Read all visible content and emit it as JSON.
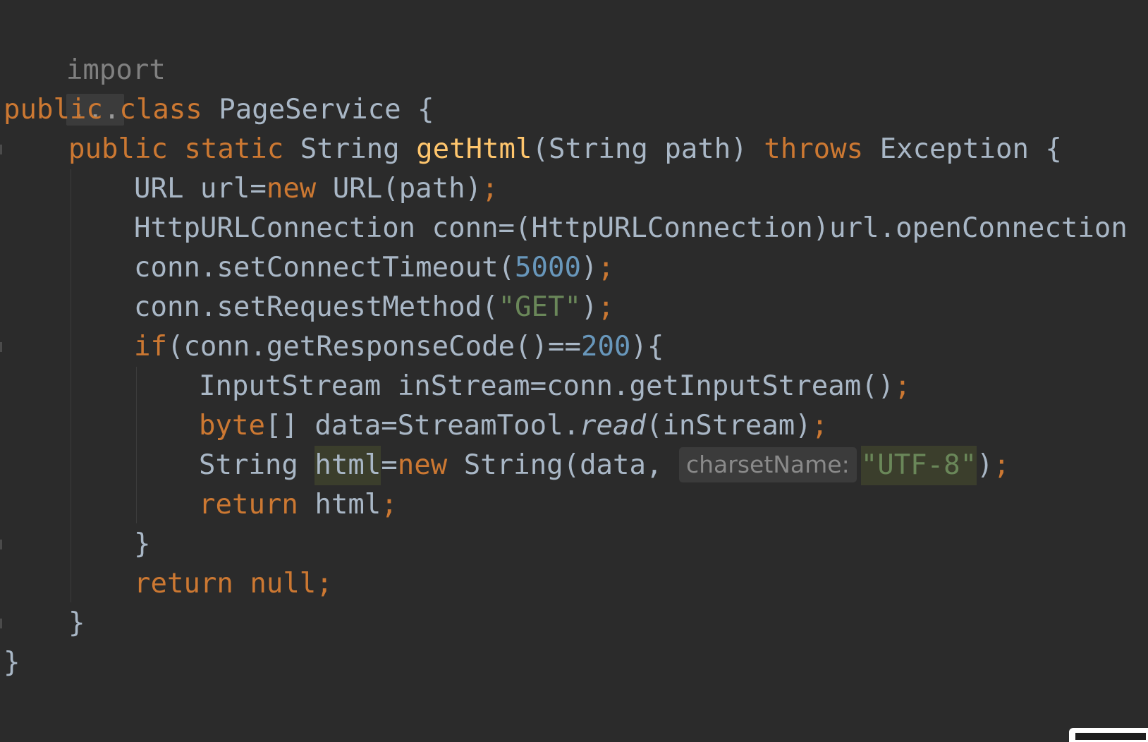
{
  "editor": {
    "colors": {
      "background": "#2b2b2b",
      "keyword": "#cc7832",
      "method": "#ffc66d",
      "number": "#6897bb",
      "string": "#6a8759",
      "identifier": "#a9b7c6"
    },
    "import_keyword": "import",
    "import_fold": "...",
    "class_header": {
      "public": "public",
      "class": "class",
      "name": "PageService",
      "brace": "{"
    },
    "method_header": {
      "public": "public",
      "static": "static",
      "return_type": "String",
      "name": "getHtml",
      "params": "(String path)",
      "throws": "throws",
      "exception": "Exception {"
    },
    "line_url": {
      "type": "URL url=",
      "new": "new",
      "rest": "URL(path)",
      "semi": ";"
    },
    "line_conn": {
      "text": "HttpURLConnection conn=(HttpURLConnection)url.openConnection"
    },
    "line_timeout": {
      "call": "conn.setConnectTimeout(",
      "value": "5000",
      "close": ")",
      "semi": ";"
    },
    "line_method": {
      "call": "conn.setRequestMethod(",
      "value": "\"GET\"",
      "close": ")",
      "semi": ";"
    },
    "line_if": {
      "kw": "if",
      "cond": "(conn.getResponseCode()==",
      "value": "200",
      "close": "){"
    },
    "line_instream": {
      "text": "InputStream inStream=conn.getInputStream()",
      "semi": ";"
    },
    "line_data": {
      "type": "byte",
      "brackets": "[] data=StreamTool.",
      "method": "read",
      "args": "(inStream)",
      "semi": ";"
    },
    "line_html": {
      "type": "String ",
      "var": "html",
      "eq": "=",
      "new": "new",
      "call": " String(data,",
      "hint": "charsetName:",
      "value": "\"UTF-8\"",
      "close": ")",
      "semi": ";"
    },
    "line_return_html": {
      "kw": "return",
      "value": " html",
      "semi": ";"
    },
    "close_if": "}",
    "line_return_null": {
      "kw": "return",
      "value": " null",
      "semi": ";"
    },
    "close_method": "}",
    "close_class": "}"
  }
}
